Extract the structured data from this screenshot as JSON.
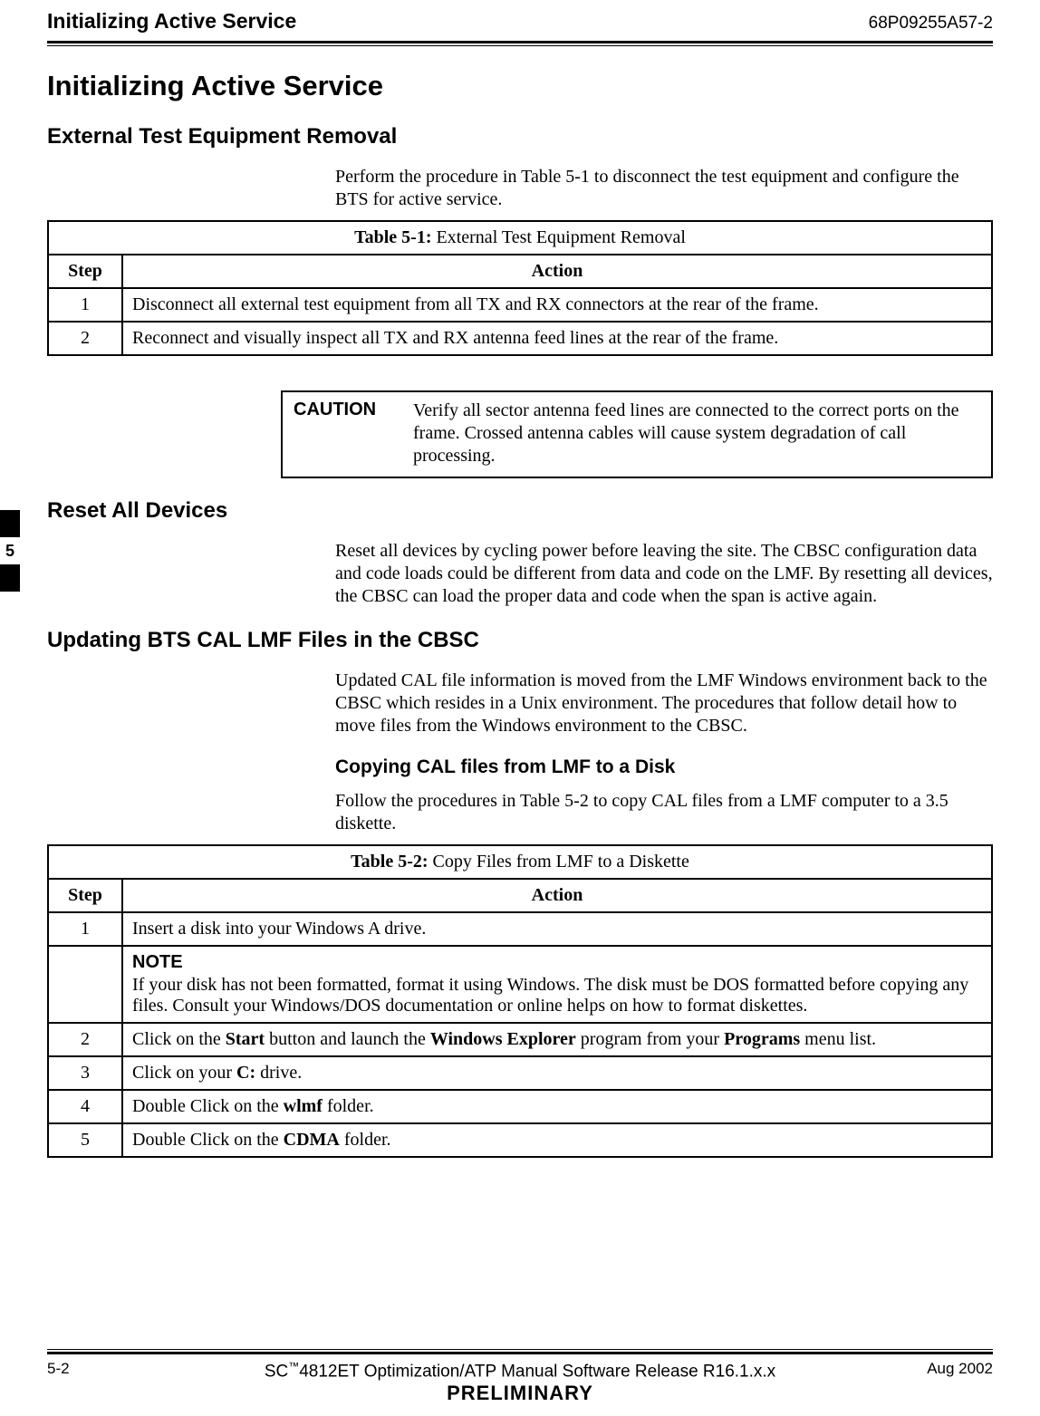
{
  "header": {
    "running_title": "Initializing Active Service",
    "doc_number": "68P09255A57-2"
  },
  "title": "Initializing Active Service",
  "section1": {
    "heading": "External Test Equipment Removal",
    "intro": "Perform the procedure in Table 5-1 to disconnect the test equipment and configure the BTS for active service."
  },
  "table51": {
    "caption_label": "Table 5-1:",
    "caption_text": " External Test Equipment Removal",
    "col_step": "Step",
    "col_action": "Action",
    "rows": [
      {
        "step": "1",
        "action": "Disconnect all external test equipment from all TX and RX connectors at the rear of the frame."
      },
      {
        "step": "2",
        "action": "Reconnect and visually inspect all TX and RX antenna feed lines at the rear of the frame."
      }
    ]
  },
  "caution": {
    "label": "CAUTION",
    "text": "Verify all sector antenna feed lines are connected to the correct ports on the frame. Crossed antenna cables will cause system degradation of call processing."
  },
  "section2": {
    "heading": "Reset All Devices",
    "body": "Reset all devices by cycling power before leaving the site. The CBSC configuration data and code loads could be different from data and code on the LMF. By resetting all devices, the CBSC can load the proper data and code when the span is active again."
  },
  "section3": {
    "heading": "Updating BTS CAL LMF Files in the CBSC",
    "body": "Updated CAL file information is moved from the LMF Windows environment back to the CBSC which resides in a Unix environment. The procedures that follow detail how to move files from the Windows environment to the CBSC.",
    "sub_heading": "Copying CAL files from LMF to a Disk",
    "sub_body": "Follow the procedures in Table 5-2 to copy CAL files from a LMF computer to a 3.5 diskette."
  },
  "table52": {
    "caption_label": "Table 5-2:",
    "caption_text": " Copy Files from LMF to a Diskette",
    "col_step": "Step",
    "col_action": "Action",
    "rows": {
      "r1_step": "1",
      "r1_action": "Insert a disk into your Windows A drive.",
      "note_label": "NOTE",
      "note_body": "If your disk has not been formatted, format it using Windows.  The disk must be DOS formatted before copying any files. Consult your Windows/DOS documentation or online helps on how to format diskettes.",
      "r2_step": "2",
      "r2_pre": "Click on the ",
      "r2_b1": "Start",
      "r2_mid1": " button and launch the ",
      "r2_b2": "Windows Explorer",
      "r2_mid2": " program from your ",
      "r2_b3": "Programs",
      "r2_post": " menu list.",
      "r3_step": "3",
      "r3_pre": "Click on your ",
      "r3_b": "C:",
      "r3_post": " drive.",
      "r4_step": "4",
      "r4_pre": "Double Click on the ",
      "r4_b": "wlmf",
      "r4_post": " folder.",
      "r5_step": "5",
      "r5_pre": "Double Click on the ",
      "r5_b": "CDMA",
      "r5_post": " folder."
    }
  },
  "side_tab": "5",
  "footer": {
    "page": "5-2",
    "center_pre": "SC",
    "center_tm": "™",
    "center_post": "4812ET Optimization/ATP Manual Software Release R16.1.x.x",
    "preliminary": "PRELIMINARY",
    "date": "Aug 2002"
  }
}
